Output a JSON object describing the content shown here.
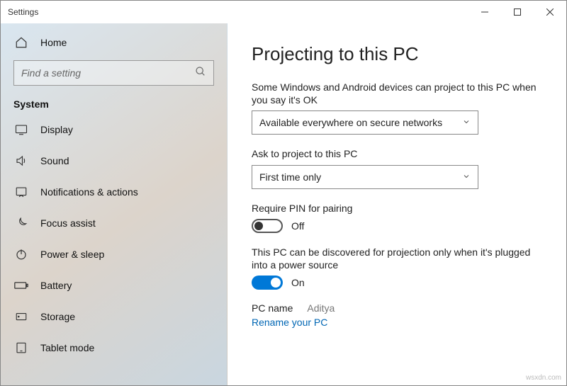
{
  "window": {
    "title": "Settings"
  },
  "sidebar": {
    "home_label": "Home",
    "search_placeholder": "Find a setting",
    "category": "System",
    "items": [
      {
        "label": "Display",
        "icon": "display-icon"
      },
      {
        "label": "Sound",
        "icon": "sound-icon"
      },
      {
        "label": "Notifications & actions",
        "icon": "notifications-icon"
      },
      {
        "label": "Focus assist",
        "icon": "moon-icon"
      },
      {
        "label": "Power & sleep",
        "icon": "power-icon"
      },
      {
        "label": "Battery",
        "icon": "battery-icon"
      },
      {
        "label": "Storage",
        "icon": "storage-icon"
      },
      {
        "label": "Tablet mode",
        "icon": "tablet-icon"
      }
    ]
  },
  "main": {
    "title": "Projecting to this PC",
    "section1_label": "Some Windows and Android devices can project to this PC when you say it's OK",
    "dropdown1_value": "Available everywhere on secure networks",
    "section2_label": "Ask to project to this PC",
    "dropdown2_value": "First time only",
    "section3_label": "Require PIN for pairing",
    "toggle1_state": "Off",
    "section4_label": "This PC can be discovered for projection only when it's plugged into a power source",
    "toggle2_state": "On",
    "pcname_label": "PC name",
    "pcname_value": "Aditya",
    "rename_link": "Rename your PC"
  },
  "watermark": "wsxdn.com"
}
